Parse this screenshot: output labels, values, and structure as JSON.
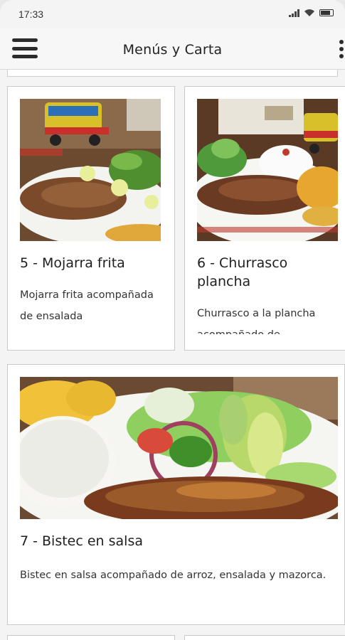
{
  "status_bar": {
    "time": "17:33",
    "icons": [
      "signal-icon",
      "wifi-icon",
      "battery-icon"
    ]
  },
  "app_bar": {
    "title": "Menús y Carta",
    "menu_icon": "hamburger-menu-icon",
    "more_icon": "more-vertical-icon"
  },
  "cards": [
    {
      "title": "5 - Mojarra frita",
      "description": "Mojarra frita acompañada de ensalada",
      "image": "fried-fish-plate-image"
    },
    {
      "title": "6 - Churrasco plancha",
      "description": "Churrasco a la plancha acompañado de",
      "image": "grilled-steak-plate-image"
    },
    {
      "title": "7 - Bistec en salsa",
      "description": "Bistec en salsa acompañado de arroz, ensalada y mazorca.",
      "image": "steak-in-sauce-plate-image"
    }
  ],
  "colors": {
    "background": "#f4f4f4",
    "card_border": "#c9c9c9",
    "text": "#1f1f1f"
  }
}
